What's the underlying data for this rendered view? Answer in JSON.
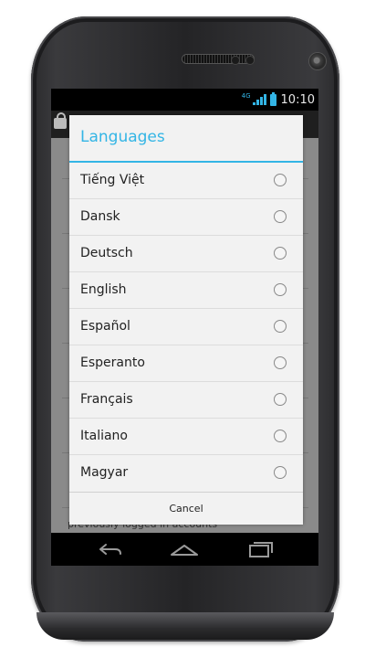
{
  "status_bar": {
    "network": "4G",
    "time": "10:10"
  },
  "background": {
    "partial_text": "previously logged in accounts"
  },
  "dialog": {
    "title": "Languages",
    "items": [
      {
        "label": "Tiếng Việt",
        "selected": false
      },
      {
        "label": "Dansk",
        "selected": false
      },
      {
        "label": "Deutsch",
        "selected": false
      },
      {
        "label": "English",
        "selected": false
      },
      {
        "label": "Español",
        "selected": false
      },
      {
        "label": "Esperanto",
        "selected": false
      },
      {
        "label": "Français",
        "selected": false
      },
      {
        "label": "Italiano",
        "selected": false
      },
      {
        "label": "Magyar",
        "selected": false
      }
    ],
    "cancel_label": "Cancel"
  },
  "colors": {
    "accent": "#33b5e5",
    "dialog_bg": "#f2f2f2"
  },
  "icons": {
    "back": "back-arrow-icon",
    "home": "home-icon",
    "recent": "recent-apps-icon"
  }
}
